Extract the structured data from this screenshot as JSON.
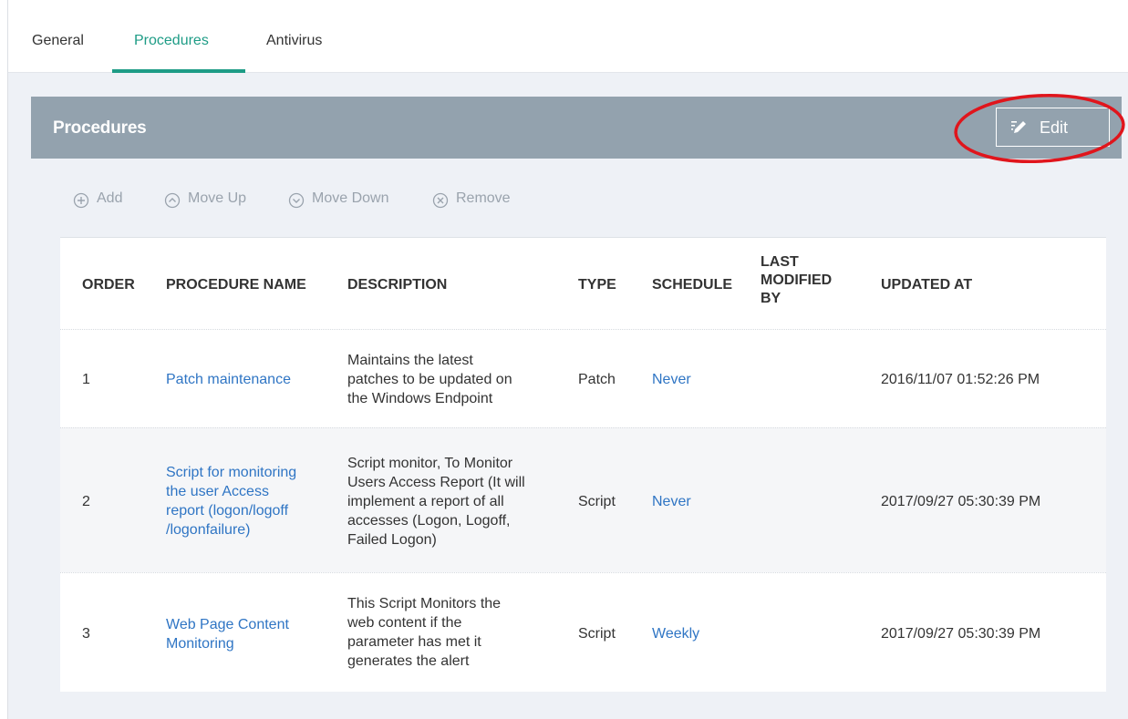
{
  "tabs": [
    {
      "label": "General"
    },
    {
      "label": "Procedures"
    },
    {
      "label": "Antivirus"
    }
  ],
  "panel": {
    "title": "Procedures",
    "edit_label": "Edit"
  },
  "toolbar": {
    "add": "Add",
    "move_up": "Move Up",
    "move_down": "Move Down",
    "remove": "Remove"
  },
  "table": {
    "headers": {
      "order": "ORDER",
      "name": "PROCEDURE NAME",
      "description": "DESCRIPTION",
      "type": "TYPE",
      "schedule": "SCHEDULE",
      "modified_by_1": "LAST",
      "modified_by_2": "MODIFIED",
      "modified_by_3": "BY",
      "updated_at": "UPDATED AT"
    },
    "rows": [
      {
        "order": "1",
        "name_lines": [
          "Patch maintenance"
        ],
        "desc_lines": [
          "Maintains the latest",
          "patches to be updated on",
          "the Windows Endpoint"
        ],
        "type": "Patch",
        "schedule": "Never",
        "updated_at": "2016/11/07 01:52:26 PM"
      },
      {
        "order": "2",
        "name_lines": [
          "Script for monitoring",
          "the user Access",
          "report (logon/logoff",
          "/logonfailure)"
        ],
        "desc_lines": [
          "Script monitor, To Monitor",
          "Users Access Report (It will",
          "implement a report of all",
          "accesses (Logon, Logoff,",
          "Failed Logon)"
        ],
        "type": "Script",
        "schedule": "Never",
        "updated_at": "2017/09/27 05:30:39 PM"
      },
      {
        "order": "3",
        "name_lines": [
          "Web Page Content",
          "Monitoring"
        ],
        "desc_lines": [
          "This Script Monitors the",
          "web content if the",
          "parameter has met it",
          "generates the alert"
        ],
        "type": "Script",
        "schedule": "Weekly",
        "updated_at": "2017/09/27 05:30:39 PM"
      }
    ]
  },
  "colors": {
    "accent": "#1e9c86",
    "header_bar": "#93a2ae",
    "link": "#2f75c4",
    "highlight": "#e0151c"
  },
  "icons": {
    "edit": "pencil-lines-icon",
    "add": "plus-circle-icon",
    "move_up": "chevron-up-circle-icon",
    "move_down": "chevron-down-circle-icon",
    "remove": "x-circle-icon"
  }
}
